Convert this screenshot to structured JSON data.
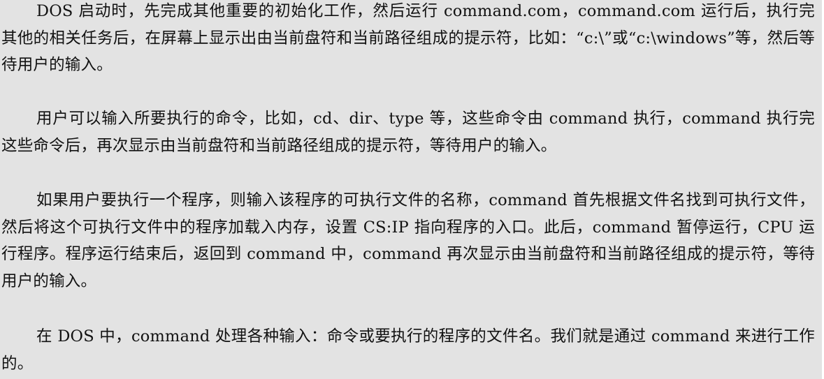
{
  "document": {
    "paragraphs": [
      "DOS 启动时，先完成其他重要的初始化工作，然后运行 command.com，command.com 运行后，执行完其他的相关任务后，在屏幕上显示出由当前盘符和当前路径组成的提示符，比如：“c:\\”或“c:\\windows”等，然后等待用户的输入。",
      "用户可以输入所要执行的命令，比如，cd、dir、type 等，这些命令由 command 执行，command 执行完这些命令后，再次显示由当前盘符和当前路径组成的提示符，等待用户的输入。",
      "如果用户要执行一个程序，则输入该程序的可执行文件的名称，command 首先根据文件名找到可执行文件，然后将这个可执行文件中的程序加载入内存，设置 CS:IP 指向程序的入口。此后，command 暂停运行，CPU 运行程序。程序运行结束后，返回到 command 中，command 再次显示由当前盘符和当前路径组成的提示符，等待用户的输入。",
      "在 DOS 中，command 处理各种输入：命令或要执行的程序的文件名。我们就是通过 command 来进行工作的。"
    ]
  }
}
